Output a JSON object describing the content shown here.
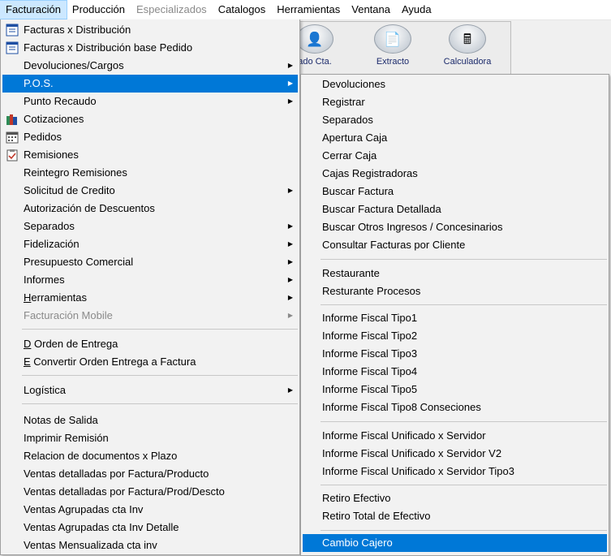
{
  "menubar": [
    {
      "label": "Facturación",
      "active": true,
      "disabled": false
    },
    {
      "label": "Producción",
      "active": false,
      "disabled": false
    },
    {
      "label": "Especializados",
      "active": false,
      "disabled": true
    },
    {
      "label": "Catalogos",
      "active": false,
      "disabled": false
    },
    {
      "label": "Herramientas",
      "active": false,
      "disabled": false
    },
    {
      "label": "Ventana",
      "active": false,
      "disabled": false
    },
    {
      "label": "Ayuda",
      "active": false,
      "disabled": false
    }
  ],
  "toolbar": {
    "estado_label": "ado Cta.",
    "extracto_label": "Extracto",
    "calculadora_label": "Calculadora"
  },
  "main_menu": {
    "items": [
      {
        "label": "Facturas x Distribución",
        "icon": "invoice-icon"
      },
      {
        "label": "Facturas x Distribución base Pedido",
        "icon": "invoice-icon"
      },
      {
        "label": "Devoluciones/Cargos",
        "submenu": true
      },
      {
        "label": "P.O.S.",
        "submenu": true,
        "highlighted": true
      },
      {
        "label": "Punto Recaudo",
        "submenu": true
      },
      {
        "label": "Cotizaciones",
        "icon": "books-icon"
      },
      {
        "label": "Pedidos",
        "icon": "calendar-icon"
      },
      {
        "label": "Remisiones",
        "icon": "checklist-icon"
      },
      {
        "label": "Reintegro Remisiones"
      },
      {
        "label": "Solicitud de Credito",
        "submenu": true
      },
      {
        "label": "Autorización de Descuentos"
      },
      {
        "label": "Separados",
        "submenu": true
      },
      {
        "label": "Fidelización",
        "submenu": true
      },
      {
        "label": "Presupuesto Comercial",
        "submenu": true
      },
      {
        "label": "Informes",
        "submenu": true
      },
      {
        "label_u": "H",
        "label_rest": "erramientas",
        "submenu": true
      },
      {
        "label": "Facturación Mobile",
        "submenu": true,
        "disabled": true
      },
      {
        "label_u": "D",
        "label_rest": " Orden de Entrega"
      },
      {
        "label_u": "E",
        "label_rest": " Convertir Orden Entrega a Factura"
      },
      {
        "label": "Logística",
        "submenu": true
      },
      {
        "label": "Notas de Salida"
      },
      {
        "label": "Imprimir Remisión"
      },
      {
        "label": "Relacion de documentos x Plazo"
      },
      {
        "label": "Ventas detalladas por Factura/Producto"
      },
      {
        "label": "Ventas detalladas por Factura/Prod/Descto"
      },
      {
        "label": "Ventas Agrupadas cta Inv"
      },
      {
        "label": "Ventas Agrupadas cta Inv Detalle"
      },
      {
        "label": "Ventas Mensualizada cta inv"
      }
    ]
  },
  "pos_menu": {
    "items": [
      {
        "label": "Devoluciones"
      },
      {
        "label": "Registrar"
      },
      {
        "label": "Separados"
      },
      {
        "label": "Apertura Caja"
      },
      {
        "label": "Cerrar Caja"
      },
      {
        "label": "Cajas Registradoras"
      },
      {
        "label": "Buscar Factura"
      },
      {
        "label": "Buscar Factura Detallada"
      },
      {
        "label": "Buscar Otros Ingresos / Concesinarios"
      },
      {
        "label": "Consultar Facturas por Cliente"
      },
      {
        "label": "Restaurante"
      },
      {
        "label": "Resturante Procesos"
      },
      {
        "label": "Informe Fiscal Tipo1"
      },
      {
        "label": "Informe Fiscal Tipo2"
      },
      {
        "label": "Informe Fiscal Tipo3"
      },
      {
        "label": "Informe Fiscal Tipo4"
      },
      {
        "label": "Informe Fiscal Tipo5"
      },
      {
        "label": "Informe Fiscal Tipo8 Conseciones"
      },
      {
        "label": "Informe Fiscal Unificado x Servidor"
      },
      {
        "label": "Informe Fiscal Unificado x Servidor V2"
      },
      {
        "label": "Informe Fiscal Unificado x Servidor Tipo3"
      },
      {
        "label": "Retiro Efectivo"
      },
      {
        "label": "Retiro Total de Efectivo"
      },
      {
        "label": "Cambio Cajero",
        "highlighted": true
      }
    ]
  },
  "colors": {
    "highlight": "#0078d7",
    "menubar_active": "#cce8ff",
    "disabled": "#8a8a8a"
  }
}
